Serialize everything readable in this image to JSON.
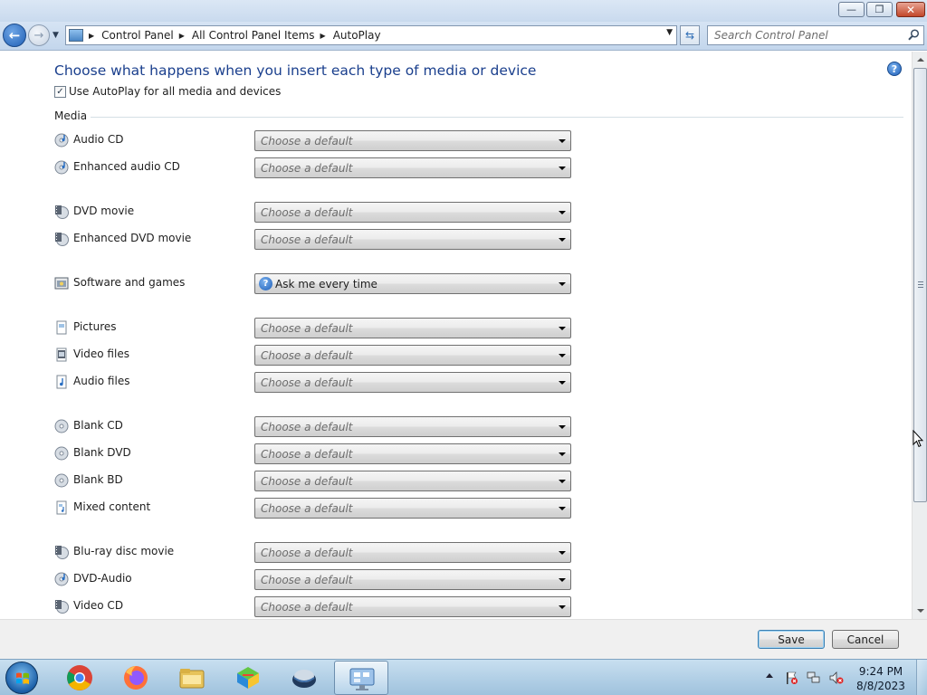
{
  "window": {
    "buttons": {
      "minimize": "—",
      "maximize": "❐",
      "close": "✕"
    }
  },
  "nav": {
    "breadcrumbs": [
      "Control Panel",
      "All Control Panel Items",
      "AutoPlay"
    ],
    "search_placeholder": "Search Control Panel"
  },
  "page": {
    "heading": "Choose what happens when you insert each type of media or device",
    "autoplay_all": {
      "label": "Use AutoPlay for all media and devices",
      "checked": true
    },
    "group_label": "Media",
    "help_glyph": "?"
  },
  "media": [
    {
      "label": "Audio CD",
      "icon": "audio-cd-icon",
      "value": "Choose a default"
    },
    {
      "label": "Enhanced audio CD",
      "icon": "enhanced-audio-cd-icon",
      "value": "Choose a default"
    },
    {
      "label": "DVD movie",
      "icon": "dvd-movie-icon",
      "value": "Choose a default"
    },
    {
      "label": "Enhanced DVD movie",
      "icon": "enhanced-dvd-movie-icon",
      "value": "Choose a default"
    },
    {
      "label": "Software and games",
      "icon": "software-games-icon",
      "value": "Ask me every time"
    },
    {
      "label": "Pictures",
      "icon": "pictures-icon",
      "value": "Choose a default"
    },
    {
      "label": "Video files",
      "icon": "video-files-icon",
      "value": "Choose a default"
    },
    {
      "label": "Audio files",
      "icon": "audio-files-icon",
      "value": "Choose a default"
    },
    {
      "label": "Blank CD",
      "icon": "blank-cd-icon",
      "value": "Choose a default"
    },
    {
      "label": "Blank DVD",
      "icon": "blank-dvd-icon",
      "value": "Choose a default"
    },
    {
      "label": "Blank BD",
      "icon": "blank-bd-icon",
      "value": "Choose a default"
    },
    {
      "label": "Mixed content",
      "icon": "mixed-content-icon",
      "value": "Choose a default"
    },
    {
      "label": "Blu-ray disc movie",
      "icon": "bluray-movie-icon",
      "value": "Choose a default"
    },
    {
      "label": "DVD-Audio",
      "icon": "dvd-audio-icon",
      "value": "Choose a default"
    },
    {
      "label": "Video CD",
      "icon": "video-cd-icon",
      "value": "Choose a default"
    }
  ],
  "buttons": {
    "save": "Save",
    "cancel": "Cancel"
  },
  "taskbar": {
    "apps": [
      "Google Chrome",
      "Mozilla Firefox",
      "Windows Explorer",
      "BlueStacks",
      "Media player",
      "Control Panel"
    ],
    "time": "9:24 PM",
    "date": "8/8/2023"
  }
}
